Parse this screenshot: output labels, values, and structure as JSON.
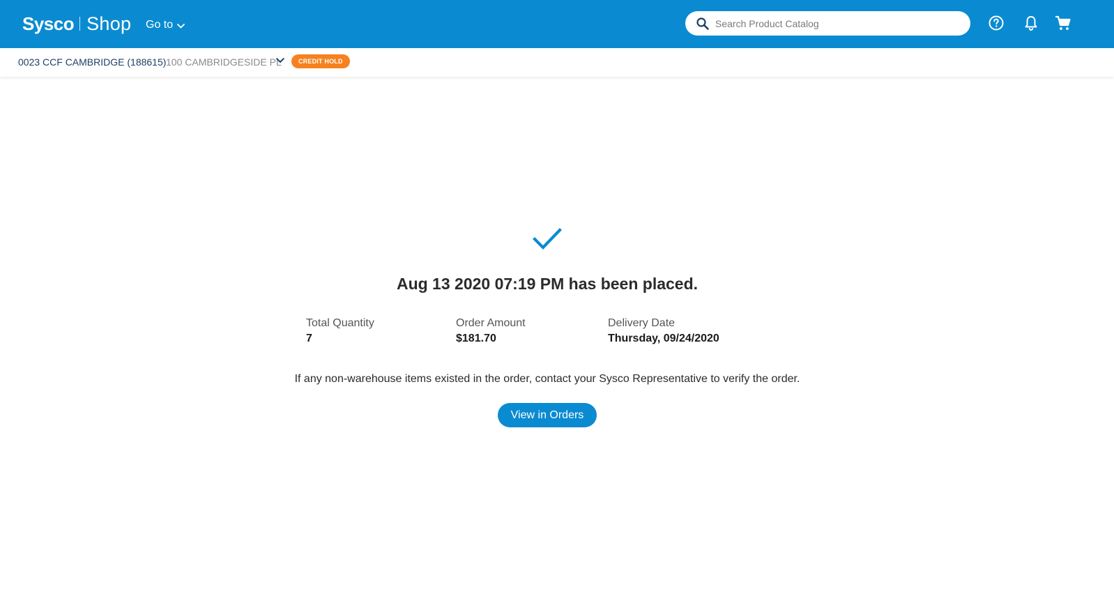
{
  "header": {
    "logo_brand": "Sysco",
    "logo_product": "Shop",
    "goto_label": "Go to",
    "search": {
      "placeholder": "Search Product Catalog",
      "value": ""
    },
    "icons": [
      "search-icon",
      "help-icon",
      "bell-icon",
      "cart-icon"
    ],
    "brand_color": "#0a8bd1"
  },
  "account_bar": {
    "account_name": "0023 CCF CAMBRIDGE (188615)",
    "address": "100 CAMBRIDGESIDE PL",
    "badge": "CREDIT HOLD",
    "badge_color": "#f6821f"
  },
  "confirmation": {
    "icon": "checkmark-icon",
    "headline": "Aug 13 2020 07:19 PM has been placed.",
    "stats": [
      {
        "label": "Total Quantity",
        "value": "7"
      },
      {
        "label": "Order Amount",
        "value": "$181.70"
      },
      {
        "label": "Delivery Date",
        "value": "Thursday, 09/24/2020"
      }
    ],
    "notice": "If any non-warehouse items existed in the order, contact your Sysco Representative to verify the order.",
    "button_label": "View in Orders"
  }
}
